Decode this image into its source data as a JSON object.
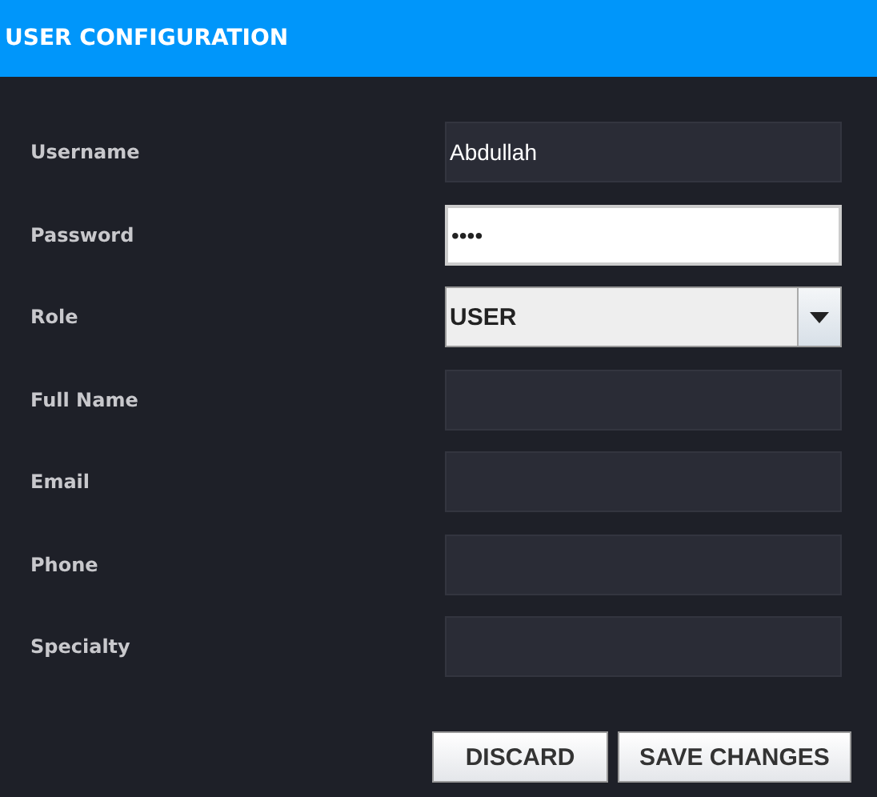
{
  "window": {
    "title": "USER CONFIGURATION"
  },
  "fields": [
    {
      "label": "Username",
      "kind": "text",
      "value": "Abdullah",
      "focused": false
    },
    {
      "label": "Password",
      "kind": "password",
      "value": "••••",
      "focused": true
    },
    {
      "label": "Role",
      "kind": "select",
      "value": "USER",
      "focused": false
    },
    {
      "label": "Full Name",
      "kind": "text",
      "focused": false
    },
    {
      "label": "Email",
      "kind": "text",
      "focused": false
    },
    {
      "label": "Phone",
      "kind": "text",
      "focused": false
    },
    {
      "label": "Specialty",
      "kind": "text",
      "focused": false
    }
  ],
  "buttons": [
    "DISCARD",
    "SAVE CHANGES"
  ]
}
